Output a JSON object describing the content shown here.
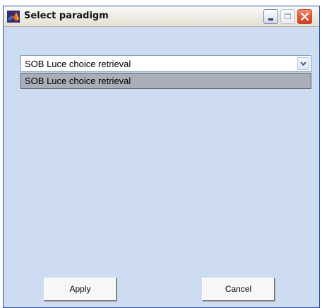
{
  "window": {
    "title": "Select paradigm",
    "icon": "matlab-icon"
  },
  "titlebar_buttons": [
    "minimize-icon",
    "maximize-icon",
    "close-icon"
  ],
  "paradigm_select": {
    "value": "SOB Luce choice retrieval",
    "options": [
      "SOB Luce choice retrieval"
    ]
  },
  "buttons": {
    "apply": "Apply",
    "cancel": "Cancel"
  },
  "colors": {
    "background": "#cddcf1",
    "highlight": "#a9aeb8",
    "close": "#df5b37"
  }
}
